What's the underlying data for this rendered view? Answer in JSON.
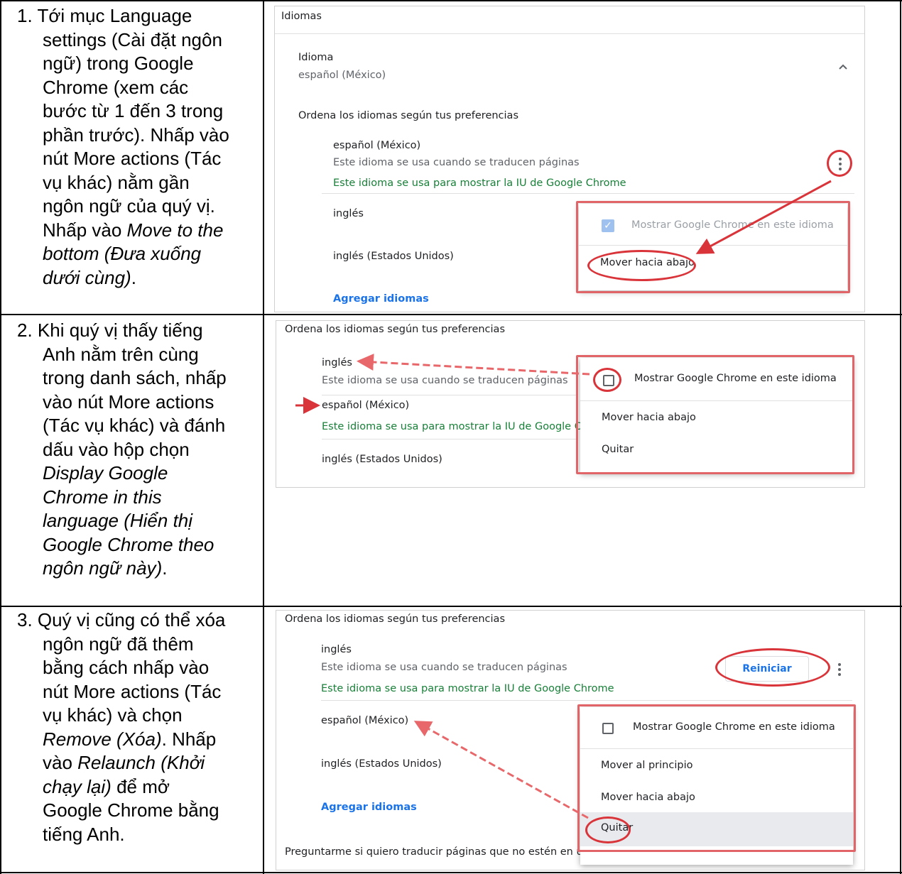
{
  "steps": [
    {
      "lines": [
        "1. Tới mục Language",
        "settings (Cài đặt ngôn",
        "ngữ) trong Google",
        "Chrome (xem các",
        "bước từ 1 đến 3 trong",
        "phần trước). Nhấp vào",
        "nút More actions (Tác",
        "vụ khác) nằm gần",
        "ngôn ngữ của quý vị.",
        "Nhấp vào",
        "Move to the",
        "bottom (Đưa xuống",
        "dưới cùng)",
        "."
      ]
    },
    {
      "lines": [
        "2. Khi quý vị thấy tiếng",
        "Anh nằm trên cùng",
        "trong danh sách, nhấp",
        "vào nút More actions",
        "(Tác vụ khác) và đánh",
        "dấu vào hộp chọn",
        "Display Google",
        "Chrome in this",
        "language (Hiển thị",
        "Google Chrome theo",
        "ngôn ngữ này)",
        "."
      ]
    },
    {
      "lines": [
        "3. Quý vị cũng có thể xóa",
        "ngôn ngữ đã thêm",
        "bằng cách nhấp vào",
        "nút More actions (Tác",
        "vụ khác) và chọn",
        "Remove (Xóa)",
        ". Nhấp",
        "vào",
        "Relaunch (Khởi",
        "chạy lại)",
        "để mở",
        "Google Chrome bằng",
        "tiếng Anh."
      ]
    }
  ],
  "shot1": {
    "header": "Idiomas",
    "lang_title": "Idioma",
    "lang_value": "español (México)",
    "order_label": "Ordena los idiomas según tus preferencias",
    "item1_name": "español (México)",
    "item1_desc": "Este idioma se usa cuando se traducen páginas",
    "item1_ui": "Este idioma se usa para mostrar la IU de Google Chrome",
    "item2_name": "inglés",
    "item3_name": "inglés (Estados Unidos)",
    "add_link": "Agregar idiomas",
    "menu_show": "Mostrar Google Chrome en este idioma",
    "menu_move_down": "Mover hacia abajo"
  },
  "shot2": {
    "order_label": "Ordena los idiomas según tus preferencias",
    "item1_name": "inglés",
    "item1_desc": "Este idioma se usa cuando se traducen páginas",
    "item2_name": "español (México)",
    "item2_ui": "Este idioma se usa para mostrar la IU de Google C",
    "item3_name": "inglés (Estados Unidos)",
    "menu_show": "Mostrar Google Chrome en este idioma",
    "menu_move_down": "Mover hacia abajo",
    "menu_remove": "Quitar"
  },
  "shot3": {
    "order_label": "Ordena los idiomas según tus preferencias",
    "item1_name": "inglés",
    "item1_desc": "Este idioma se usa cuando se traducen páginas",
    "item1_ui": "Este idioma se usa para mostrar la IU de Google Chrome",
    "relaunch": "Reiniciar",
    "item2_name": "español (México)",
    "item3_name": "inglés (Estados Unidos)",
    "add_link": "Agregar idiomas",
    "bottom_text": "Preguntarme si quiero traducir páginas que no estén en u",
    "menu_show": "Mostrar Google Chrome en este idioma",
    "menu_move_top": "Mover al principio",
    "menu_move_down": "Mover hacia abajo",
    "menu_remove": "Quitar"
  },
  "colors": {
    "annotation_red": "#d9343a",
    "link_blue": "#1a73e8",
    "ui_green": "#188038"
  },
  "icons": [
    "chevron-up-icon",
    "more-vert-icon",
    "checkbox-icon",
    "arrow-icon"
  ]
}
